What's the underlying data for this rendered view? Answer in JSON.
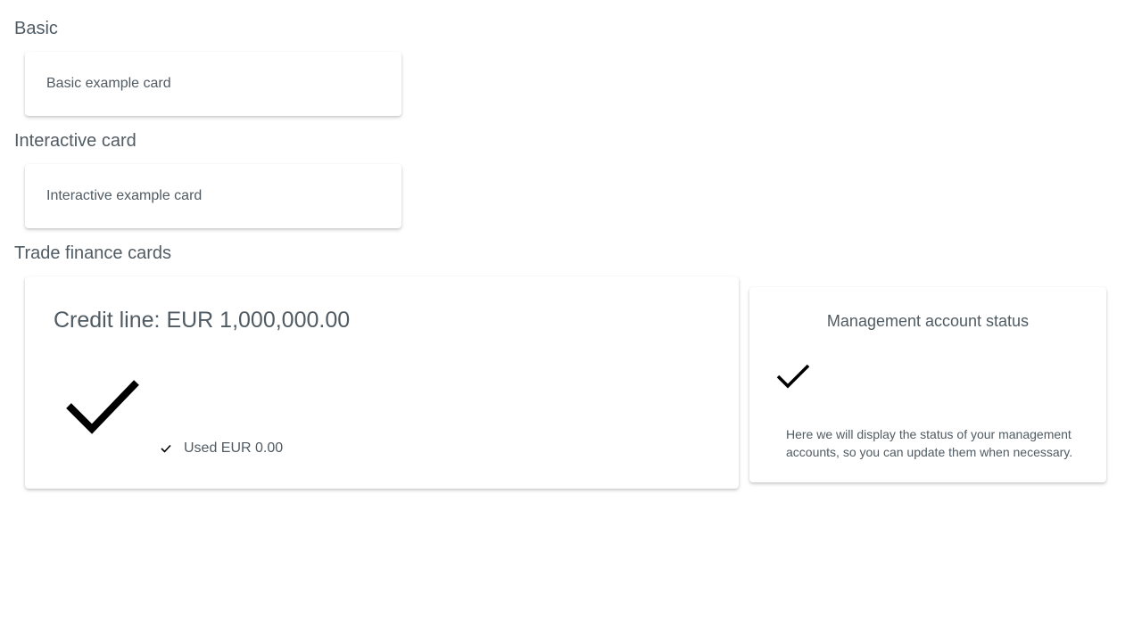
{
  "sections": {
    "basic": {
      "title": "Basic",
      "card_text": "Basic example card"
    },
    "interactive": {
      "title": "Interactive card",
      "card_text": "Interactive example card"
    },
    "trade_finance": {
      "title": "Trade finance cards",
      "credit_card": {
        "title": "Credit line: EUR 1,000,000.00",
        "status_icon": "checkmark-icon",
        "used_label": "Used EUR 0.00",
        "used_icon": "checkmark-icon"
      },
      "management_card": {
        "title": "Management account status",
        "status_icon": "checkmark-icon",
        "description": "Here we will display the status of your management accounts, so you can update them when necessary."
      }
    }
  },
  "colors": {
    "text": "#505b63",
    "icon": "#000000",
    "card_background": "#ffffff"
  }
}
